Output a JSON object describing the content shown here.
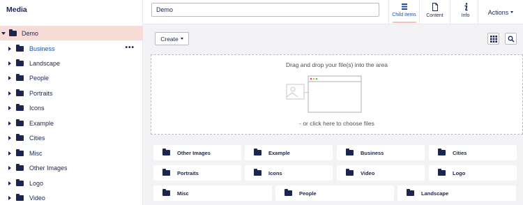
{
  "sidebar": {
    "title": "Media",
    "root": {
      "label": "Demo"
    },
    "items": [
      {
        "label": "Business",
        "active": true
      },
      {
        "label": "Landscape"
      },
      {
        "label": "People"
      },
      {
        "label": "Portraits"
      },
      {
        "label": "Icons"
      },
      {
        "label": "Example"
      },
      {
        "label": "Cities"
      },
      {
        "label": "Misc"
      },
      {
        "label": "Other Images"
      },
      {
        "label": "Logo"
      },
      {
        "label": "Video"
      }
    ],
    "more_icon": "•••"
  },
  "header": {
    "name_value": "Demo",
    "tabs": [
      {
        "label": "Child items",
        "icon": "list-icon",
        "active": true
      },
      {
        "label": "Content",
        "icon": "document-icon"
      },
      {
        "label": "Info",
        "icon": "info-icon"
      }
    ],
    "actions_label": "Actions"
  },
  "toolbar": {
    "create_label": "Create",
    "grid_icon": "grid-icon",
    "search_icon": "search-icon"
  },
  "dropzone": {
    "title": "Drag and drop your file(s) into the area",
    "link": "- or click here to choose files"
  },
  "folders": [
    {
      "label": "Other Images"
    },
    {
      "label": "Example"
    },
    {
      "label": "Business"
    },
    {
      "label": "Cities"
    },
    {
      "label": "Portraits"
    },
    {
      "label": "Icons"
    },
    {
      "label": "Video"
    },
    {
      "label": "Logo"
    },
    {
      "label": "Misc"
    },
    {
      "label": "People"
    },
    {
      "label": "Landscape"
    }
  ],
  "colors": {
    "primary": "#1b264f",
    "accent": "#f5c1bc",
    "selected_bg": "#f9dbd5",
    "link_blue": "#2152a3",
    "background": "#f3f3f5"
  }
}
